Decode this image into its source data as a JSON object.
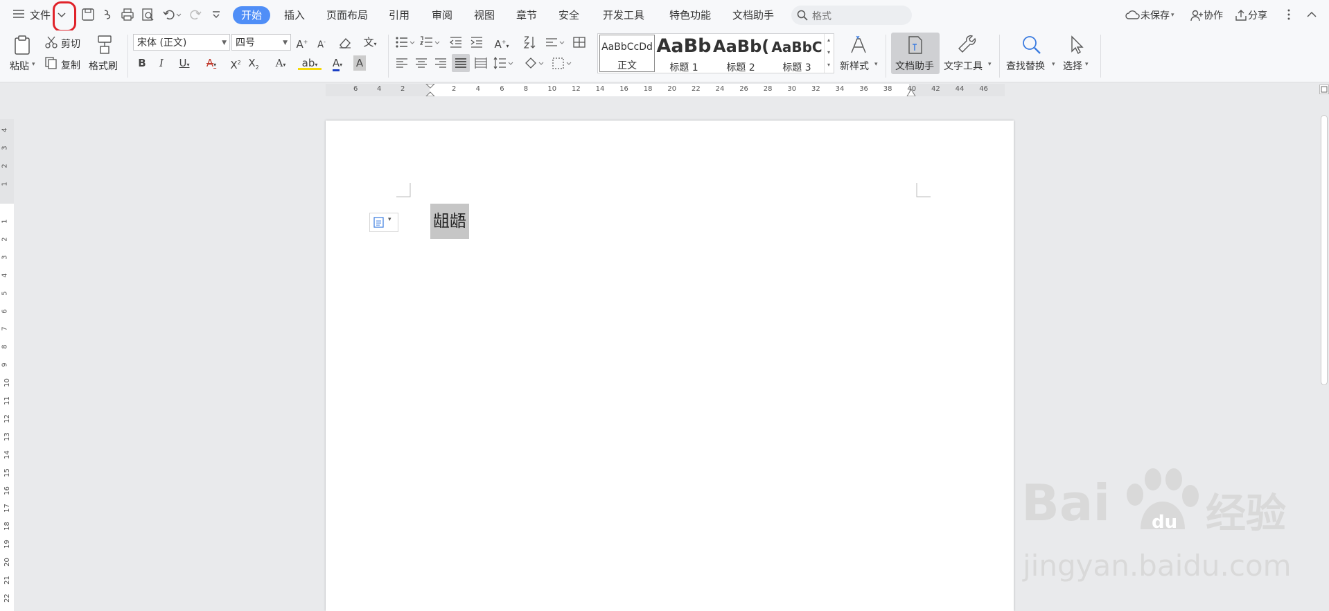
{
  "menubar": {
    "file_label": "文件",
    "tabs": [
      "开始",
      "插入",
      "页面布局",
      "引用",
      "审阅",
      "视图",
      "章节",
      "安全",
      "开发工具",
      "特色功能",
      "文档助手"
    ],
    "active_tab": "开始",
    "search_placeholder": "格式",
    "unsaved": "未保存",
    "collab": "协作",
    "share": "分享"
  },
  "ribbon": {
    "paste": "粘贴",
    "cut": "剪切",
    "copy": "复制",
    "format_painter": "格式刷",
    "font_name": "宋体 (正文)",
    "font_size": "四号",
    "styles": [
      {
        "preview": "AaBbCcDd",
        "name": "正文"
      },
      {
        "preview": "AaBb",
        "name": "标题 1"
      },
      {
        "preview": "AaBb(",
        "name": "标题 2"
      },
      {
        "preview": "AaBbC",
        "name": "标题 3"
      }
    ],
    "new_style": "新样式",
    "doc_assistant": "文档助手",
    "text_tools": "文字工具",
    "find_replace": "查找替换",
    "select": "选择"
  },
  "ruler": {
    "h_left": [
      "6",
      "4",
      "2"
    ],
    "h_right": [
      "2",
      "4",
      "6",
      "8",
      "10",
      "12",
      "14",
      "16",
      "18",
      "20",
      "22",
      "24",
      "26",
      "28",
      "30",
      "32",
      "34",
      "36",
      "38",
      "40",
      "42",
      "44",
      "46"
    ],
    "v_top": [
      "4",
      "3",
      "2",
      "1"
    ],
    "v_main": [
      "1",
      "2",
      "3",
      "4",
      "5",
      "6",
      "7",
      "8",
      "9",
      "10",
      "11",
      "12",
      "13",
      "14",
      "15",
      "16",
      "17",
      "18",
      "19",
      "20",
      "21",
      "22"
    ]
  },
  "document": {
    "text": "龃龉"
  },
  "watermark": {
    "brand": "Bai",
    "suffix": "经验",
    "url": "jingyan.baidu.com"
  },
  "colors": {
    "accent": "#4f8ef7",
    "annotation": "#e0232a",
    "selection": "#c6c6c6"
  }
}
